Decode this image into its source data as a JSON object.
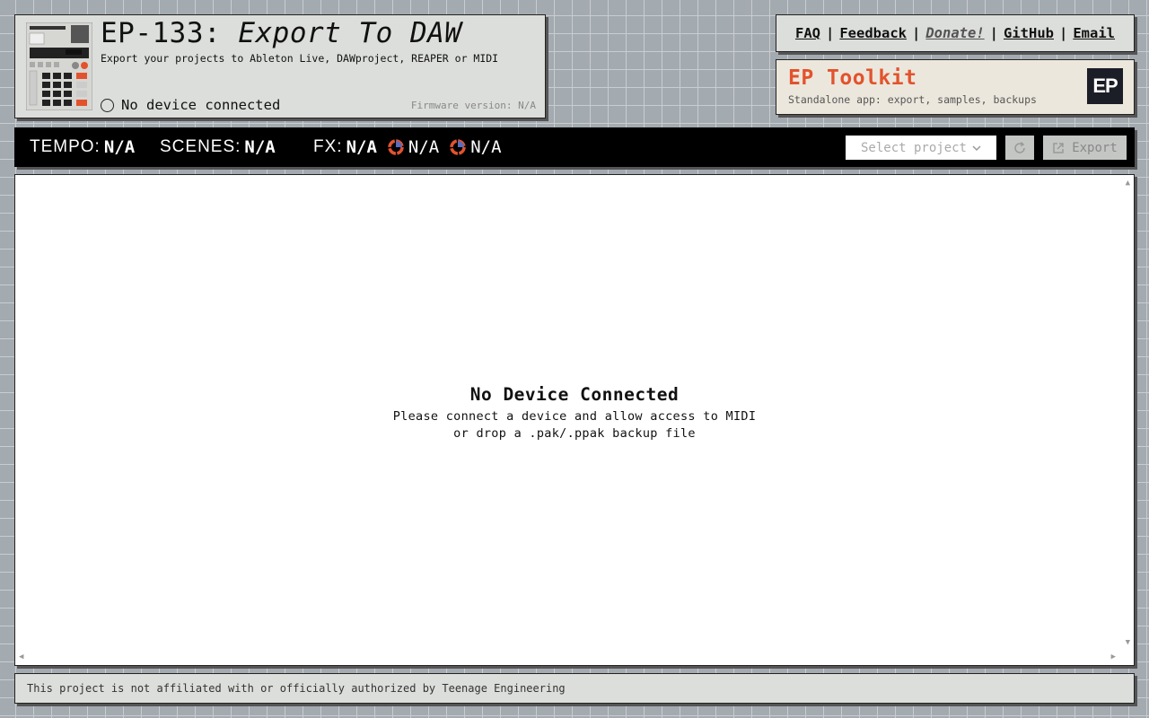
{
  "header": {
    "title_prefix": "EP-133:",
    "title_italic": "Export To DAW",
    "subtitle": "Export your projects to Ableton Live, DAWproject, REAPER or MIDI",
    "status": "No device connected",
    "firmware": "Firmware version: N/A"
  },
  "links": [
    "FAQ",
    "Feedback",
    "Donate!",
    "GitHub",
    "Email"
  ],
  "link_separator": "|",
  "toolkit": {
    "title": "EP Toolkit",
    "subtitle": "Standalone app: export, samples, backups",
    "badge": "EP"
  },
  "toolbar": {
    "tempo_label": "TEMPO:",
    "tempo_value": "N/A",
    "scenes_label": "SCENES:",
    "scenes_value": "N/A",
    "fx_label": "FX:",
    "fx_value": "N/A",
    "fx_param1": "N/A",
    "fx_param2": "N/A",
    "select_placeholder": "Select project",
    "export_label": "Export"
  },
  "main": {
    "empty_title": "No Device Connected",
    "empty_line1": "Please connect a device and allow access to MIDI",
    "empty_line2": "or drop a .pak/.ppak backup file"
  },
  "footer": "This project is not affiliated with or officially authorized by Teenage Engineering",
  "colors": {
    "accent": "#e2532d",
    "background": "#a3aab0",
    "panel": "#dcdedb",
    "toolbar": "#000000"
  }
}
